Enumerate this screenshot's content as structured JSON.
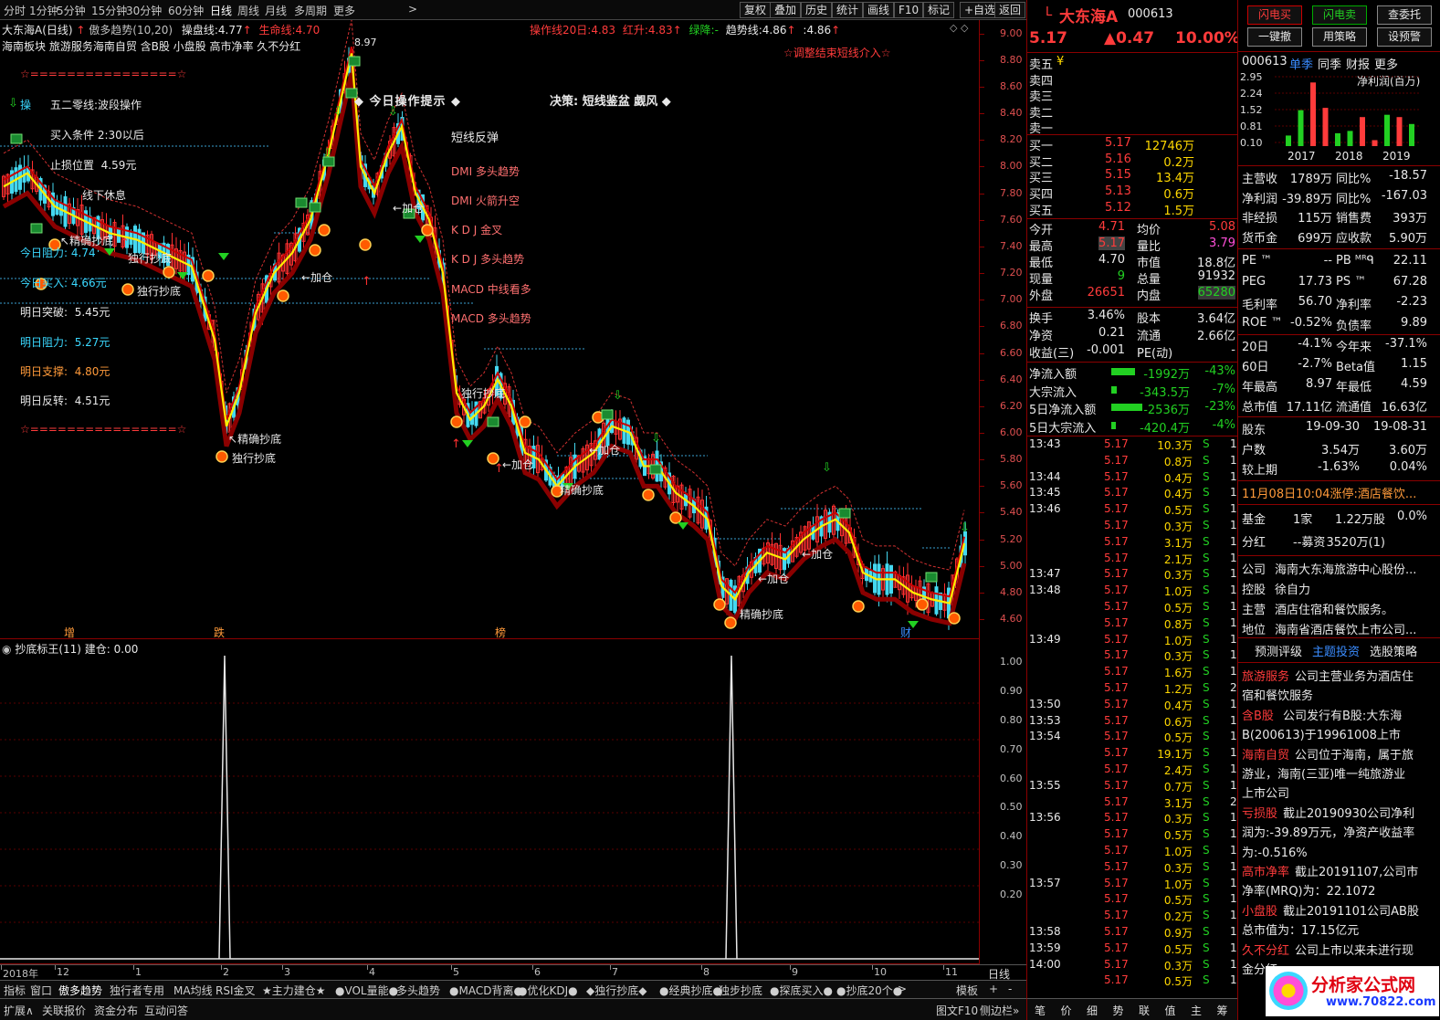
{
  "toolbar": {
    "periods": [
      "分时",
      "1分钟",
      "5分钟",
      "15分钟",
      "30分钟",
      "60分钟",
      "日线",
      "周线",
      "月线",
      "多周期",
      "更多"
    ],
    "more_arrow": ">",
    "right_buttons": [
      "复权",
      "叠加",
      "历史",
      "统计",
      "画线",
      "F10",
      "标记",
      "+自选",
      "返回"
    ]
  },
  "chart_header": {
    "title": "大东海A(日线)",
    "indicator": "傲多趋势(10,20)",
    "lines": [
      {
        "label": "操盘线:",
        "value": "4.77",
        "arrow": "↑"
      },
      {
        "label": "生命线:",
        "value": "4.70"
      }
    ],
    "right_items": [
      {
        "label": "操作线20日:",
        "value": "4.83"
      },
      {
        "label": "红升:",
        "value": "4.83",
        "arrow": "↑"
      },
      {
        "label": "绿降:",
        "value": "-"
      },
      {
        "label": "趋势线:",
        "value": "4.86",
        "arrow": "↑"
      },
      {
        "label": ":",
        "value": "4.86",
        "arrow": "↑"
      }
    ],
    "concepts": "海南板块 旅游服务海南自贸 含B股 小盘股 高市净率 久不分红",
    "star_note": "☆调整结束短线介入☆",
    "top_price": "8.97"
  },
  "left_panel": {
    "star_line": "☆================☆",
    "operate": "操",
    "title": "五二零线:波段操作",
    "buy_cond": "买入条件 2:30以后",
    "stop_loss": {
      "label": "止损位置",
      "value": "4.59元"
    },
    "resist_today": {
      "label": "今日阻力:",
      "value": "4.74"
    },
    "buy_today": {
      "label": "今日买入:",
      "value": "4.66元"
    },
    "rows": [
      {
        "label": "明日突破:",
        "value": "5.45元"
      },
      {
        "label": "明日阻力:",
        "value": "5.27元"
      },
      {
        "label": "明日支撑:",
        "value": "4.80元"
      },
      {
        "label": "明日反转:",
        "value": "4.51元"
      }
    ],
    "precise": "精确抄底",
    "solo": "独行抄底",
    "addpos": "加仓",
    "sell_below": "线下休息"
  },
  "tips": {
    "title": "◆ 今日操作提示 ◆",
    "decision": "决策: 短线鉴盆 觑风 ◆",
    "rebound": "短线反弹",
    "items": [
      "DMI 多头趋势",
      "DMI 火箭升空",
      "K D J 金叉",
      "K D J 多头趋势",
      "MACD 中线看多",
      "MACD 多头趋势"
    ]
  },
  "chart_data": {
    "type": "candlestick",
    "y_ticks": [
      9.0,
      8.8,
      8.6,
      8.4,
      8.2,
      8.0,
      7.8,
      7.6,
      7.4,
      7.2,
      7.0,
      6.8,
      6.6,
      6.4,
      6.2,
      6.0,
      5.8,
      5.6,
      5.4,
      5.2,
      5.0,
      4.8,
      4.6
    ],
    "x_labels": [
      "2018年",
      "12",
      "1",
      "2",
      "3",
      "4",
      "5",
      "6",
      "7",
      "8",
      "9",
      "10",
      "11"
    ],
    "bottom_markers": [
      "增",
      "跌",
      "榜",
      "财"
    ],
    "sub_title": "抄底标王(11)",
    "sub_value": "建仓: 0.00",
    "sub_y_ticks": [
      1.0,
      0.9,
      0.8,
      0.7,
      0.6,
      0.5,
      0.4,
      0.3,
      0.2
    ],
    "period_label": "日线"
  },
  "tabs": {
    "items": [
      "指标",
      "窗口",
      "傲多趋势",
      "独行者专用",
      "MA均线",
      "RSI金叉",
      "★主力建仓★",
      "●VOL量能●",
      "多头趋势",
      "●MACD背离●",
      "●优化KDJ●",
      "◆独行抄底◆",
      "●经典抄底●",
      "独步抄底",
      "●探底买入●",
      "●抄底20个●",
      ">"
    ],
    "template": "模板",
    "plus": "+",
    "minus": "-"
  },
  "bottom": {
    "items": [
      "扩展∧",
      "关联报价",
      "资金分布",
      "互动问答"
    ],
    "right": "图文F10",
    "side": "侧边栏»"
  },
  "quote": {
    "code": "000613",
    "name": "大东海A",
    "l": "L",
    "price": "5.17",
    "change": "▲0.47",
    "pct": "10.00%",
    "asks": [
      {
        "l": "卖五",
        "p": "",
        "v": "¥"
      },
      {
        "l": "卖四",
        "p": "",
        "v": ""
      },
      {
        "l": "卖三",
        "p": "",
        "v": ""
      },
      {
        "l": "卖二",
        "p": "",
        "v": ""
      },
      {
        "l": "卖一",
        "p": "",
        "v": ""
      }
    ],
    "bids": [
      {
        "l": "买一",
        "p": "5.17",
        "v": "12746万"
      },
      {
        "l": "买二",
        "p": "5.16",
        "v": "0.2万"
      },
      {
        "l": "买三",
        "p": "5.15",
        "v": "13.4万"
      },
      {
        "l": "买四",
        "p": "5.13",
        "v": "0.6万"
      },
      {
        "l": "买五",
        "p": "5.12",
        "v": "1.5万"
      }
    ],
    "stats": [
      {
        "l1": "今开",
        "v1": "4.71",
        "l2": "均价",
        "v2": "5.08"
      },
      {
        "l1": "最高",
        "v1": "5.17",
        "l2": "量比",
        "v2": "3.79"
      },
      {
        "l1": "最低",
        "v1": "4.70",
        "l2": "市值",
        "v2": "18.8亿"
      },
      {
        "l1": "现量",
        "v1": "9",
        "l2": "总量",
        "v2": "91932"
      },
      {
        "l1": "外盘",
        "v1": "26651",
        "l2": "内盘",
        "v2": "65280"
      }
    ],
    "stats2": [
      {
        "l1": "换手",
        "v1": "3.46%",
        "l2": "股本",
        "v2": "3.64亿"
      },
      {
        "l1": "净资",
        "v1": "0.21",
        "l2": "流通",
        "v2": "2.66亿"
      },
      {
        "l1": "收益(三)",
        "v1": "-0.001",
        "l2": "PE(动)",
        "v2": "-"
      }
    ],
    "flows": [
      {
        "l": "净流入额",
        "v": "-1992万",
        "p": "-43%",
        "w": 26
      },
      {
        "l": "大宗流入",
        "v": "-343.5万",
        "p": "-7%",
        "w": 6
      },
      {
        "l": "5日净流入额",
        "v": "-2536万",
        "p": "-23%",
        "w": 34
      },
      {
        "l": "5日大宗流入",
        "v": "-420.4万",
        "p": "-4%",
        "w": 5
      }
    ],
    "ticks": [
      [
        "13:43",
        "5.17",
        "10.3万",
        "S",
        "1"
      ],
      [
        "",
        "5.17",
        "0.8万",
        "S",
        "1"
      ],
      [
        "13:44",
        "5.17",
        "0.4万",
        "S",
        "1"
      ],
      [
        "13:45",
        "5.17",
        "0.4万",
        "S",
        "1"
      ],
      [
        "13:46",
        "5.17",
        "0.5万",
        "S",
        "1"
      ],
      [
        "",
        "5.17",
        "0.3万",
        "S",
        "1"
      ],
      [
        "",
        "5.17",
        "3.1万",
        "S",
        "1"
      ],
      [
        "",
        "5.17",
        "2.1万",
        "S",
        "1"
      ],
      [
        "13:47",
        "5.17",
        "0.3万",
        "S",
        "1"
      ],
      [
        "13:48",
        "5.17",
        "1.0万",
        "S",
        "1"
      ],
      [
        "",
        "5.17",
        "0.5万",
        "S",
        "1"
      ],
      [
        "",
        "5.17",
        "0.8万",
        "S",
        "1"
      ],
      [
        "13:49",
        "5.17",
        "1.0万",
        "S",
        "1"
      ],
      [
        "",
        "5.17",
        "0.3万",
        "S",
        "1"
      ],
      [
        "",
        "5.17",
        "1.6万",
        "S",
        "1"
      ],
      [
        "",
        "5.17",
        "1.2万",
        "S",
        "2"
      ],
      [
        "13:50",
        "5.17",
        "0.4万",
        "S",
        "1"
      ],
      [
        "13:53",
        "5.17",
        "0.6万",
        "S",
        "1"
      ],
      [
        "13:54",
        "5.17",
        "0.5万",
        "S",
        "1"
      ],
      [
        "",
        "5.17",
        "19.1万",
        "S",
        "1"
      ],
      [
        "",
        "5.17",
        "2.4万",
        "S",
        "1"
      ],
      [
        "13:55",
        "5.17",
        "0.7万",
        "S",
        "1"
      ],
      [
        "",
        "5.17",
        "3.1万",
        "S",
        "2"
      ],
      [
        "13:56",
        "5.17",
        "0.3万",
        "S",
        "1"
      ],
      [
        "",
        "5.17",
        "0.5万",
        "S",
        "1"
      ],
      [
        "",
        "5.17",
        "1.0万",
        "S",
        "1"
      ],
      [
        "",
        "5.17",
        "0.3万",
        "S",
        "1"
      ],
      [
        "13:57",
        "5.17",
        "1.0万",
        "S",
        "1"
      ],
      [
        "",
        "5.17",
        "0.5万",
        "S",
        "1"
      ],
      [
        "",
        "5.17",
        "0.2万",
        "S",
        "1"
      ],
      [
        "13:58",
        "5.17",
        "0.9万",
        "S",
        "1"
      ],
      [
        "13:59",
        "5.17",
        "0.5万",
        "S",
        "1"
      ],
      [
        "14:00",
        "5.17",
        "0.3万",
        "S",
        "1"
      ],
      [
        "",
        "5.17",
        "0.5万",
        "S",
        "1"
      ]
    ],
    "bottom_tabs": [
      "笔",
      "价",
      "细",
      "势",
      "联",
      "值",
      "主",
      "筹"
    ]
  },
  "info": {
    "btn_row1": [
      "闪电买",
      "闪电卖",
      "查委托"
    ],
    "btn_row2": [
      "一键撤",
      "用策略",
      "设预警"
    ],
    "code": "000613",
    "tabs": [
      "单季",
      "同季",
      "财报",
      "更多"
    ],
    "chart_title": "净利润(百万)",
    "bar_yticks": [
      "2.95",
      "2.24",
      "1.52",
      "0.81",
      "0.10"
    ],
    "bar_xlabels": [
      "2017",
      "2018",
      "2019"
    ],
    "bars": [
      {
        "v": 0.4,
        "c": "green"
      },
      {
        "v": 1.5,
        "c": "green"
      },
      {
        "v": 2.7,
        "c": "red"
      },
      {
        "v": 1.6,
        "c": "red"
      },
      {
        "v": 0.5,
        "c": "green"
      },
      {
        "v": 0.6,
        "c": "green"
      },
      {
        "v": 1.2,
        "c": "red"
      },
      {
        "v": 0.2,
        "c": "red"
      },
      {
        "v": 1.3,
        "c": "green"
      },
      {
        "v": 1.2,
        "c": "red"
      },
      {
        "v": 0.9,
        "c": "green"
      }
    ],
    "fin": [
      {
        "l1": "主营收",
        "v1": "1789万",
        "l2": "同比%",
        "v2": "-18.57",
        "c2": "white"
      },
      {
        "l1": "净利润",
        "v1": "-39.89万",
        "l2": "同比%",
        "v2": "-167.03",
        "c2": "white"
      },
      {
        "l1": "非经损",
        "v1": "115万",
        "l2": "销售费",
        "v2": "393万",
        "c2": "white"
      },
      {
        "l1": "货币金",
        "v1": "699万",
        "l2": "应收款",
        "v2": "5.90万",
        "c2": "white"
      }
    ],
    "val": [
      {
        "l1": "PE ™",
        "v1": "--",
        "l2": "PB ᴹᴿᑫ",
        "v2": "22.11"
      },
      {
        "l1": "PEG",
        "v1": "17.73",
        "l2": "PS ™",
        "v2": "67.28"
      },
      {
        "l1": "毛利率",
        "v1": "56.70",
        "l2": "净利率",
        "v2": "-2.23"
      },
      {
        "l1": "ROE ™",
        "v1": "-0.52%",
        "l2": "负债率",
        "v2": "9.89"
      }
    ],
    "perf": [
      {
        "l1": "20日",
        "v1": "-4.1%",
        "l2": "今年来",
        "v2": "-37.1%"
      },
      {
        "l1": "60日",
        "v1": "-2.7%",
        "l2": "Beta值",
        "v2": "1.15"
      },
      {
        "l1": "年最高",
        "v1": "8.97",
        "l2": "年最低",
        "v2": "4.59"
      },
      {
        "l1": "总市值",
        "v1": "17.11亿",
        "l2": "流通值",
        "v2": "16.63亿"
      }
    ],
    "holders": [
      {
        "l": "股东",
        "v1": "19-09-30",
        "v2": "19-08-31"
      },
      {
        "l": "户数",
        "v1": "3.54万",
        "v2": "3.60万"
      },
      {
        "l": "较上期",
        "v1": "-1.63%",
        "v2": "0.04%"
      }
    ],
    "news": "11月08日10:04涨停:酒店餐饮...",
    "fund": [
      {
        "l": "基金",
        "v1": "1家",
        "v2": "1.22万股",
        "v3": "0.0%"
      },
      {
        "l": "分红",
        "v1": "--募资",
        "v2": "3520万(1)",
        "v3": ""
      }
    ],
    "company": [
      {
        "l": "公司",
        "v": "海南大东海旅游中心股份..."
      },
      {
        "l": "控股",
        "v": "徐自力"
      },
      {
        "l": "主营",
        "v": "酒店住宿和餐饮服务。"
      },
      {
        "l": "地位",
        "v": "海南省酒店餐饮上市公司..."
      }
    ],
    "sub_tabs": [
      "预测评级",
      "主题投资",
      "选股策略"
    ],
    "themes": [
      {
        "t": "旅游服务",
        "lines": [
          "公司主营业务为酒店住",
          "宿和餐饮服务"
        ]
      },
      {
        "t": "含B股",
        "lines": [
          "公司发行有B股:大东海",
          "B(200613)于19961008上市"
        ]
      },
      {
        "t": "海南自贸",
        "lines": [
          "公司位于海南，属于旅",
          "游业，海南(三亚)唯一纯旅游业",
          "上市公司"
        ]
      },
      {
        "t": "亏损股",
        "lines": [
          "截止20190930公司净利",
          "润为:-39.89万元，净资产收益率",
          "为:-0.516%"
        ]
      },
      {
        "t": "高市净率",
        "lines": [
          "截止20191107,公司市",
          "净率(MRQ)为：22.1072"
        ]
      },
      {
        "t": "小盘股",
        "lines": [
          "截止20191101公司AB股",
          "总市值为：17.15亿元"
        ]
      },
      {
        "t": "久不分红",
        "lines": [
          "公司上市以来未进行现",
          "金分红"
        ]
      }
    ],
    "watermark": "分析家公式网",
    "watermark_url": "www.70822.com"
  }
}
